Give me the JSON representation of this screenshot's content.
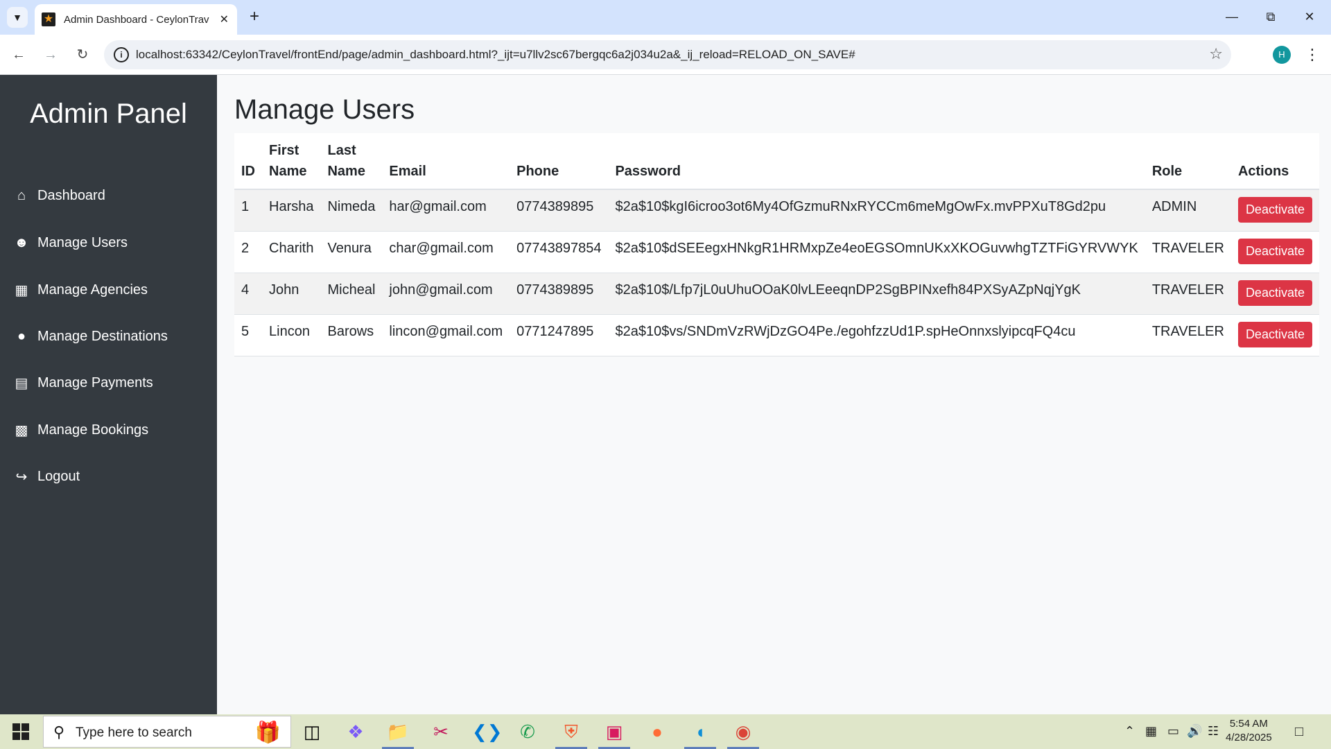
{
  "browser": {
    "tab_title": "Admin Dashboard - CeylonTravel",
    "url": "localhost:63342/CeylonTravel/frontEnd/page/admin_dashboard.html?_ijt=u7llv2sc67bergqc6a2j034u2a&_ij_reload=RELOAD_ON_SAVE#",
    "profile_initial": "H",
    "icons": {
      "tab_search": "chevron-down-icon",
      "favicon": "star-icon",
      "close": "close-icon",
      "new_tab": "plus-icon",
      "back": "back-arrow-icon",
      "forward": "forward-arrow-icon",
      "reload": "reload-icon",
      "site_info": "info-icon",
      "bookmark": "star-outline-icon",
      "menu": "three-dots-icon"
    }
  },
  "sidebar": {
    "title": "Admin Panel",
    "items": [
      {
        "label": "Dashboard",
        "icon": "home-icon"
      },
      {
        "label": "Manage Users",
        "icon": "users-icon"
      },
      {
        "label": "Manage Agencies",
        "icon": "building-icon"
      },
      {
        "label": "Manage Destinations",
        "icon": "map-pin-icon"
      },
      {
        "label": "Manage Payments",
        "icon": "credit-card-icon"
      },
      {
        "label": "Manage Bookings",
        "icon": "book-icon"
      },
      {
        "label": "Logout",
        "icon": "sign-out-icon"
      }
    ]
  },
  "main": {
    "title": "Manage Users",
    "columns": [
      "ID",
      "First Name",
      "Last Name",
      "Email",
      "Phone",
      "Password",
      "Role",
      "Actions"
    ],
    "rows": [
      {
        "id": "1",
        "first": "Harsha",
        "last": "Nimeda",
        "email": "har@gmail.com",
        "phone": "0774389895",
        "password": "$2a$10$kgI6icroo3ot6My4OfGzmuRNxRYCCm6meMgOwFx.mvPPXuT8Gd2pu",
        "role": "ADMIN",
        "action": "Deactivate"
      },
      {
        "id": "2",
        "first": "Charith",
        "last": "Venura",
        "email": "char@gmail.com",
        "phone": "07743897854",
        "password": "$2a$10$dSEEegxHNkgR1HRMxpZe4eoEGSOmnUKxXKOGuvwhgTZTFiGYRVWYK",
        "role": "TRAVELER",
        "action": "Deactivate"
      },
      {
        "id": "4",
        "first": "John",
        "last": "Micheal",
        "email": "john@gmail.com",
        "phone": "0774389895",
        "password": "$2a$10$/Lfp7jL0uUhuOOaK0lvLEeeqnDP2SgBPINxefh84PXSyAZpNqjYgK",
        "role": "TRAVELER",
        "action": "Deactivate"
      },
      {
        "id": "5",
        "first": "Lincon",
        "last": "Barows",
        "email": "lincon@gmail.com",
        "phone": "0771247895",
        "password": "$2a$10$vs/SNDmVzRWjDzGO4Pe./egohfzzUd1P.spHeOnnxslyipcqFQ4cu",
        "role": "TRAVELER",
        "action": "Deactivate"
      }
    ]
  },
  "taskbar": {
    "search_placeholder": "Type here to search",
    "time": "5:54 AM",
    "date": "4/28/2025",
    "apps": [
      "task-view-icon",
      "copilot-icon",
      "file-explorer-icon",
      "snipping-tool-icon",
      "vscode-icon",
      "whatsapp-icon",
      "brave-icon",
      "intellij-icon",
      "postman-icon",
      "edge-icon",
      "chrome-icon"
    ]
  },
  "colors": {
    "sidebar_bg": "#343a40",
    "danger": "#dc3545",
    "tabstrip_bg": "#d3e3fd",
    "taskbar_bg": "#dfe6c9"
  }
}
